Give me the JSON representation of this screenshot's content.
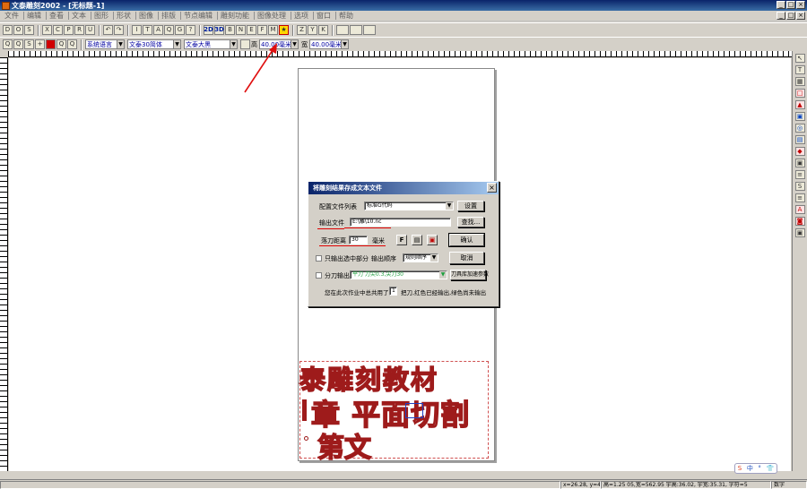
{
  "titlebar": {
    "title": "文泰雕刻2002 - [无标题-1]",
    "buttons": [
      "_",
      "□",
      "×"
    ]
  },
  "menubar": {
    "items": [
      "文件",
      "编辑",
      "查看",
      "文本",
      "图形",
      "形状",
      "图像",
      "排版",
      "节点编辑",
      "雕刻功能",
      "图像处理",
      "选项",
      "窗口",
      "帮助"
    ],
    "mdi_buttons": [
      "_",
      "□",
      "×"
    ]
  },
  "toolbar1": {
    "buttons": [
      "D",
      "O",
      "S",
      "X",
      "C",
      "P",
      "R",
      "U",
      "↶",
      "↷",
      "I",
      "T",
      "A",
      "Q",
      "G",
      "?",
      "2D",
      "3D",
      "B",
      "N",
      "E",
      "F",
      "M",
      "★",
      "Z",
      "Y",
      "K"
    ]
  },
  "toolbar2": {
    "buttons": [
      "Q",
      "Q",
      "S",
      "+",
      "■",
      "Q",
      "Q"
    ],
    "language": "系统语言",
    "font_cn": "文泰30简体",
    "font_en": "文泰大黑",
    "height_label": "高",
    "height_value": "40.00毫米",
    "width_label": "宽",
    "width_value": "40.00毫米"
  },
  "right_tools": [
    "↖",
    "T",
    "▦",
    "□",
    "▲",
    "▣",
    "◎",
    "▤",
    "◆",
    "▣",
    "≡",
    "S",
    "≡",
    "A",
    "◙",
    "▣"
  ],
  "artwork": {
    "line1": "泰雕刻教材",
    "line2": "章 平面切割",
    "line3": "第文"
  },
  "dialog": {
    "title": "将雕刻结果存成文本文件",
    "close": "×",
    "config_list_label": "配置文件列表",
    "config_value": "标准G代码",
    "settings_button": "设置",
    "output_file_label": "输出文件",
    "output_file_value": "E:\\雕\\10.nc",
    "browse_button": "查找...",
    "retract_label": "落刀距离",
    "retract_value": "30",
    "retract_unit": "毫米",
    "icon_buttons": [
      "F",
      "▤",
      "▣"
    ],
    "ok_button": "确认",
    "only_selected_label": "只输出选中部分",
    "output_order_label": "输出顺序",
    "output_order_value": "规则顺序",
    "cancel_button": "取消",
    "tool_output_label": "分刀输出",
    "tool_output_value": "平刀  刀尖0.3,尖刀30",
    "tool_lib_button": "刀具库加速参数",
    "summary_prefix": "您在此次作业中总共用了",
    "summary_count": "1",
    "summary_suffix": "把刀,红色已经输出,绿色尚未输出"
  },
  "status": {
    "coords": "x=26.28, y=40.81",
    "size": "高=1.25 05,宽=562.95 宇高:36.02, 宇宽:35.31, 字符=5",
    "mode": "数字"
  },
  "ime": {
    "items": [
      "S",
      "中",
      "°",
      "👕"
    ]
  }
}
